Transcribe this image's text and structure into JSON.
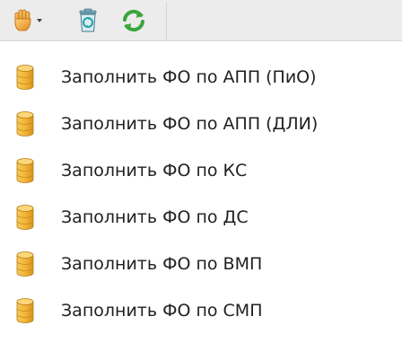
{
  "toolbar": {
    "buttons": [
      {
        "icon": "hand-icon",
        "has_dropdown": true
      },
      {
        "icon": "recycle-bin-icon"
      },
      {
        "icon": "refresh-icon"
      }
    ]
  },
  "colors": {
    "toolbar_bg": "#ececec",
    "db_gold": "#e8a922",
    "refresh_green": "#3aa53a",
    "recycle_teal": "#2b9fa6"
  },
  "menu": {
    "items": [
      {
        "label": "Заполнить ФО по АПП (ПиО)",
        "icon": "database-icon"
      },
      {
        "label": "Заполнить ФО по АПП (ДЛИ)",
        "icon": "database-icon"
      },
      {
        "label": "Заполнить ФО по КС",
        "icon": "database-icon"
      },
      {
        "label": "Заполнить ФО по ДС",
        "icon": "database-icon"
      },
      {
        "label": "Заполнить ФО по ВМП",
        "icon": "database-icon"
      },
      {
        "label": "Заполнить ФО по СМП",
        "icon": "database-icon"
      }
    ]
  }
}
